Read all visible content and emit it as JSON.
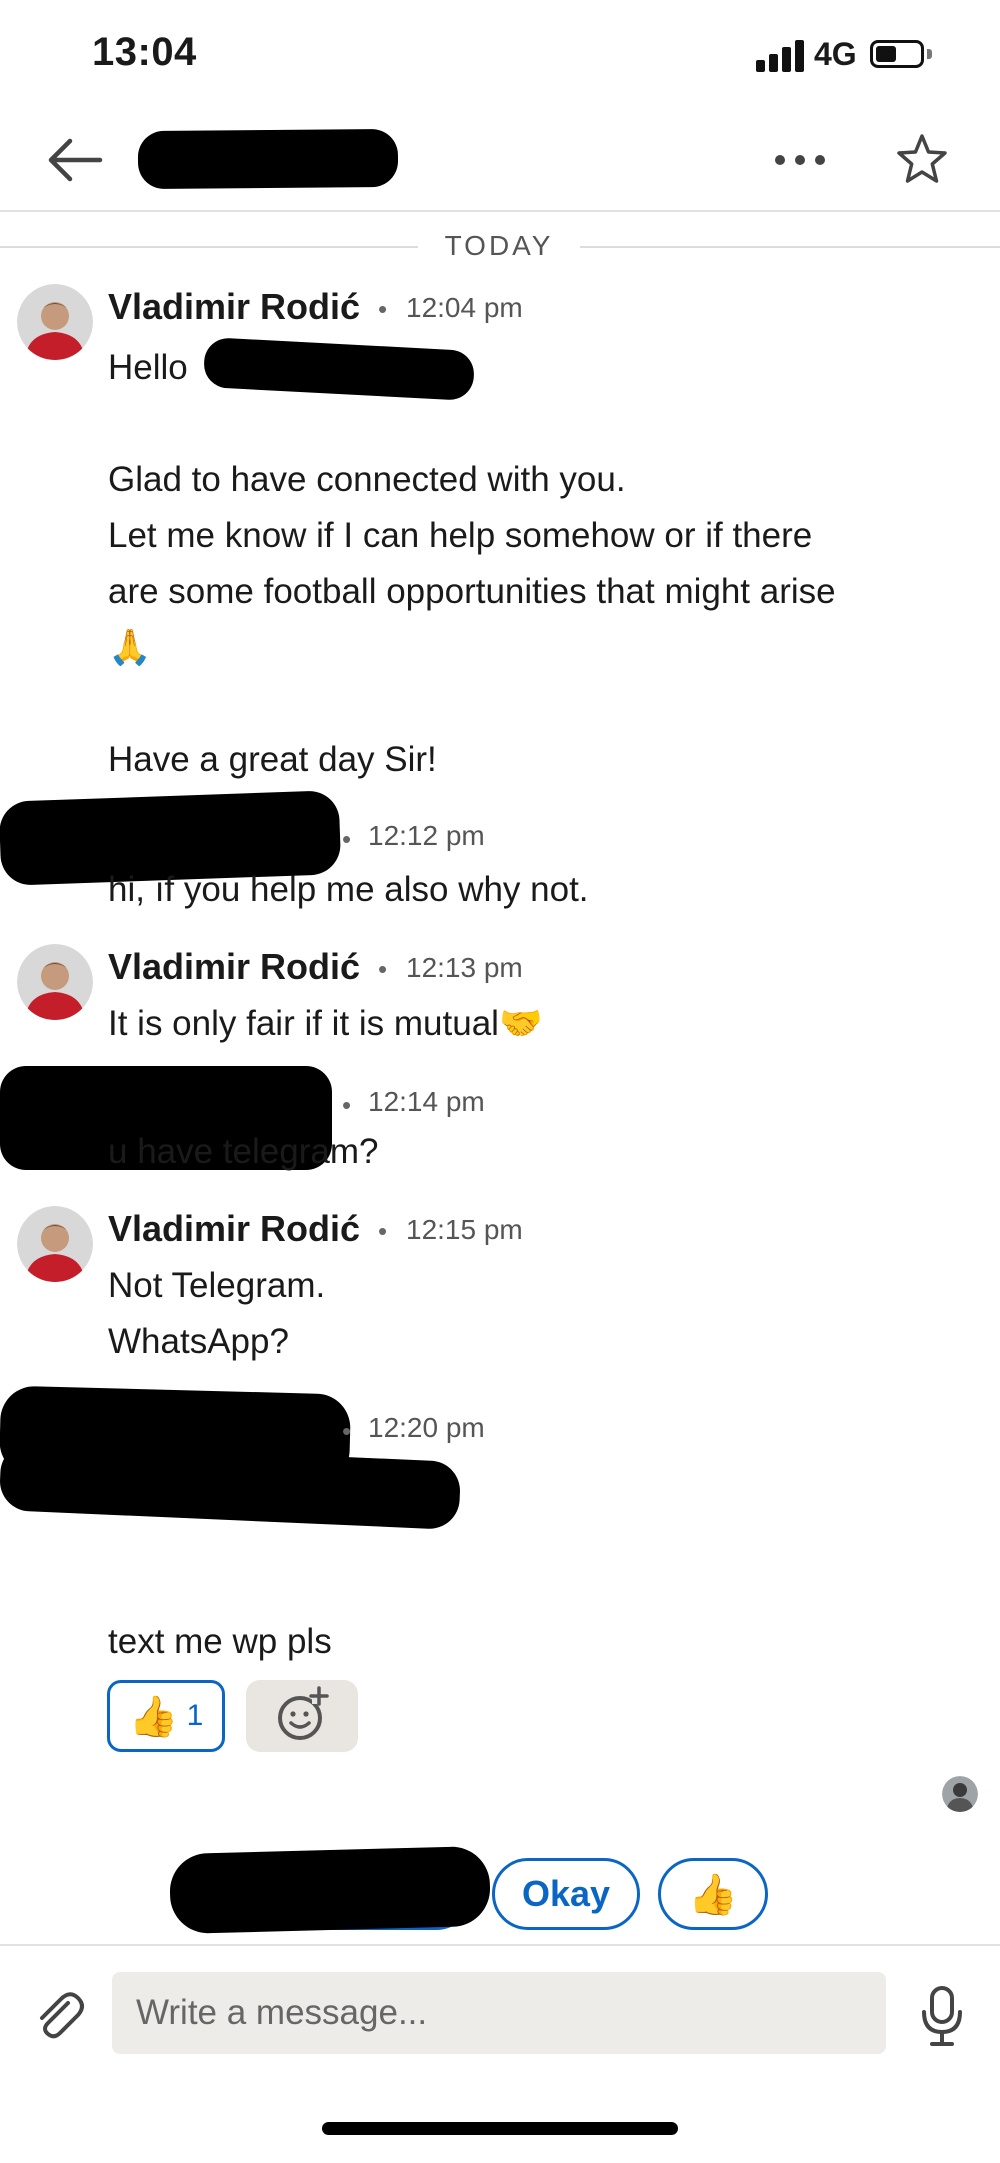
{
  "status_bar": {
    "time": "13:04",
    "network": "4G"
  },
  "conversation": {
    "date_divider": "TODAY",
    "messages": [
      {
        "sender": "Vladimir Rodić",
        "time": "12:04 pm",
        "lines": [
          "Hello",
          "",
          "Glad to have connected with you.",
          "Let me know if I can help somehow or if there",
          "are some football opportunities that might arise",
          "🙏",
          "",
          "Have a great day Sir!"
        ]
      },
      {
        "sender": "",
        "time": "12:12 pm",
        "lines": [
          "hi, ıf you help me also why not."
        ]
      },
      {
        "sender": "Vladimir Rodić",
        "time": "12:13 pm",
        "lines": [
          "It is only fair if it is mutual🤝"
        ]
      },
      {
        "sender": "",
        "time": "12:14 pm",
        "lines": [
          "u have telegram?"
        ]
      },
      {
        "sender": "Vladimir Rodić",
        "time": "12:15 pm",
        "lines": [
          "Not Telegram.",
          "WhatsApp?"
        ]
      },
      {
        "sender": "",
        "time": "12:20 pm",
        "lines": [
          "text me wp pls"
        ]
      }
    ],
    "reaction": {
      "emoji": "👍",
      "count": "1"
    }
  },
  "suggestions": {
    "okay": "Okay",
    "thumbs": "👍"
  },
  "composer": {
    "placeholder": "Write a message..."
  },
  "icons": {
    "back": "arrow-left-icon",
    "more": "more-horizontal-icon",
    "star": "star-icon",
    "attach": "paperclip-icon",
    "mic": "microphone-icon",
    "add_reaction": "smiley-plus-icon"
  },
  "colors": {
    "accent": "#0a66c2",
    "input_bg": "#eeece8",
    "reaction_add_bg": "#e9e6e1"
  }
}
